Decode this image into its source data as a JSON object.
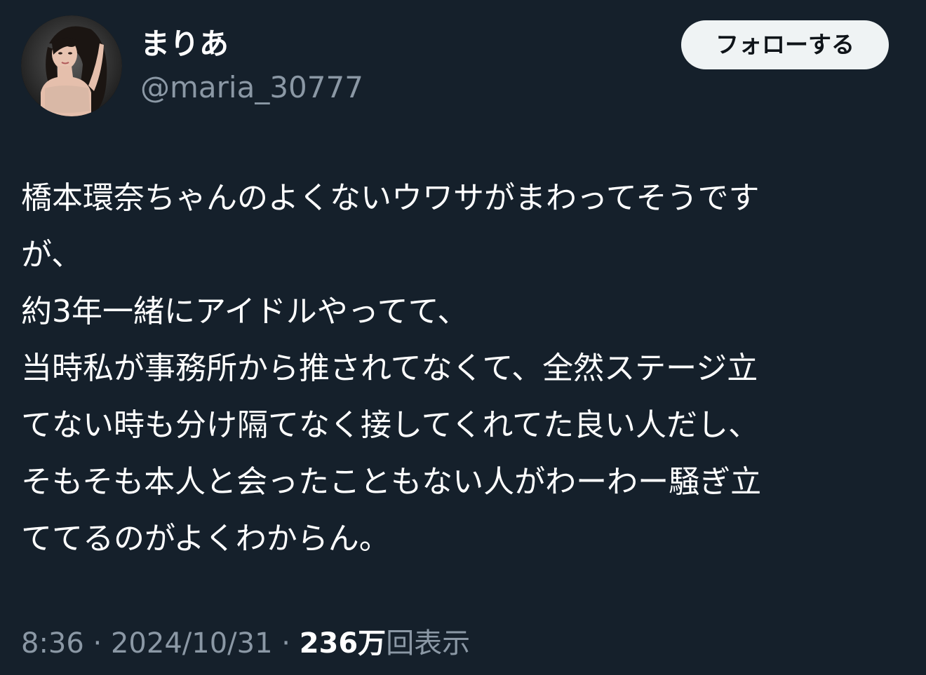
{
  "author": {
    "display_name": "まりあ",
    "handle": "@maria_30777"
  },
  "follow_button": {
    "label": "フォローする"
  },
  "tweet": {
    "lines": [
      "橋本環奈ちゃんのよくないウワサがまわってそうです",
      "が、",
      "約3年一緒にアイドルやってて、",
      "当時私が事務所から推されてなくて、全然ステージ立",
      "てない時も分け隔てなく接してくれてた良い人だし、",
      "そもそも本人と会ったこともない人がわーわー騒ぎ立",
      "ててるのがよくわからん。"
    ]
  },
  "meta": {
    "time": "8:36",
    "separator": " · ",
    "date": "2024/10/31",
    "views_count": "236万",
    "views_label": "回表示"
  },
  "colors": {
    "background": "#15202b",
    "text_primary": "#ffffff",
    "text_secondary": "#8b98a5",
    "button_bg": "#eff3f4",
    "button_text": "#0f1419"
  }
}
